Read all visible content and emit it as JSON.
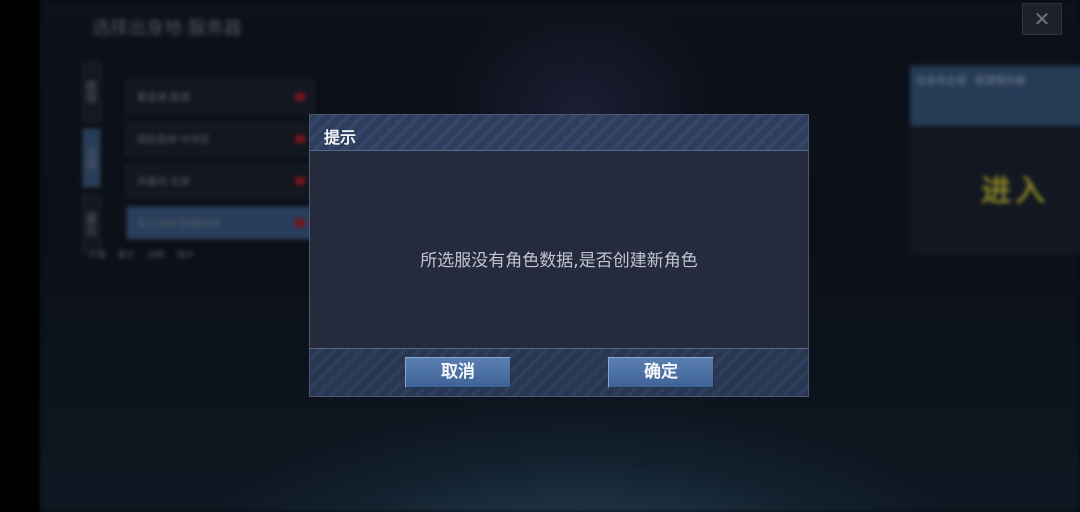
{
  "background": {
    "title": "选择出身地·服务器",
    "close_glyph": "✕",
    "tabs": [
      "推荐",
      "全部",
      "最近"
    ],
    "server_list": [
      "繁星港·联盟",
      "暗影森林·中央区",
      "风暴岛·东部",
      "极光海域·联盟前线"
    ],
    "legend": [
      "火爆",
      "繁忙",
      "流畅",
      "维护"
    ],
    "side_panel": {
      "heading": "出身地主城 · 联盟服务器",
      "enter_label": "进入"
    }
  },
  "dialog": {
    "title": "提示",
    "message": "所选服没有角色数据,是否创建新角色",
    "cancel_label": "取消",
    "confirm_label": "确定"
  },
  "colors": {
    "dialog_bg": "#262a3d",
    "header_stripe": "#34476a",
    "button_blue": "#4a6fa3"
  }
}
